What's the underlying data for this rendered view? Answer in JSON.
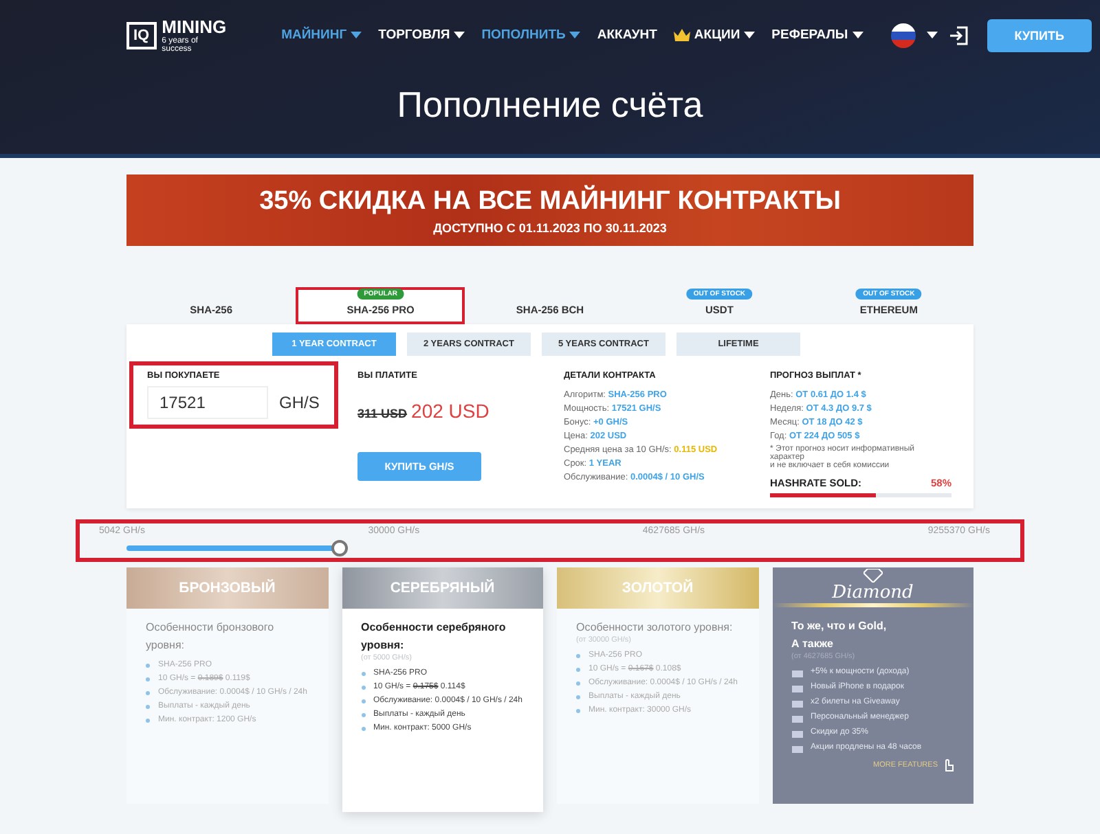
{
  "header": {
    "logo_mark": "IQ",
    "logo_name": "MINING",
    "logo_tagline": "6 years of success",
    "nav": [
      {
        "label": "МАЙНИНГ",
        "selected": true,
        "dropdown": true,
        "kind": "plain"
      },
      {
        "label": "ТОРГОВЛЯ",
        "selected": false,
        "dropdown": true,
        "kind": "plain"
      },
      {
        "label": "ПОПОЛНИТЬ",
        "selected": true,
        "dropdown": true,
        "kind": "plain"
      },
      {
        "label": "АККАУНТ",
        "selected": false,
        "dropdown": false,
        "kind": "plain"
      },
      {
        "label": "АКЦИИ",
        "selected": false,
        "dropdown": true,
        "kind": "crown"
      },
      {
        "label": "РЕФЕРАЛЫ",
        "selected": false,
        "dropdown": true,
        "kind": "plain"
      }
    ],
    "buy_button": "КУПИТЬ"
  },
  "page_title": "Пополнение счёта",
  "banner": {
    "headline": "35% СКИДКА НА ВСЕ МАЙНИНГ КОНТРАКТЫ",
    "subline": "ДОСТУПНО С 01.11.2023 ПО 30.11.2023"
  },
  "algo_tabs": [
    {
      "label": "SHA-256",
      "selected": false,
      "highlighted": false
    },
    {
      "label": "SHA-256 PRO",
      "selected": true,
      "highlighted": true,
      "badge": {
        "text": "POPULAR",
        "color": "#2e9a3a"
      }
    },
    {
      "label": "SHA-256 BCH",
      "selected": false,
      "highlighted": false
    },
    {
      "label": "USDT",
      "selected": false,
      "highlighted": false,
      "badge": {
        "text": "OUT OF STOCK",
        "color": "#3aa0e6"
      }
    },
    {
      "label": "ETHEREUM",
      "selected": false,
      "highlighted": false,
      "badge": {
        "text": "OUT OF STOCK",
        "color": "#3aa0e6"
      }
    }
  ],
  "contract_tabs": [
    {
      "label": "1 YEAR CONTRACT",
      "selected": true
    },
    {
      "label": "2 YEARS CONTRACT",
      "selected": false
    },
    {
      "label": "5 YEARS CONTRACT",
      "selected": false
    },
    {
      "label": "LIFETIME",
      "selected": false
    }
  ],
  "purchase": {
    "heading": "ВЫ ПОКУПАЕТЕ",
    "value": "17521",
    "unit": "GH/S",
    "highlighted": true
  },
  "payment": {
    "heading": "ВЫ ПЛАТИТЕ",
    "old_price": "311 USD",
    "price": "202 USD",
    "button": "КУПИТЬ GH/S"
  },
  "details": {
    "heading": "ДЕТАЛИ КОНТРАКТА",
    "rows": [
      {
        "label": "Алгоритм:",
        "value": "SHA-256 PRO",
        "color": "#3fa3e6"
      },
      {
        "label": "Мощность:",
        "value": "17521 GH/S",
        "color": "#3fa3e6"
      },
      {
        "label": "Бонус:",
        "value": "+0 GH/S",
        "color": "#3fa3e6"
      },
      {
        "label": "Цена:",
        "value": "202 USD",
        "color": "#3fa3e6"
      },
      {
        "label": "Средняя цена за 10 GH/s:",
        "value": "0.115 USD",
        "color": "#e6b800"
      },
      {
        "label": "Срок:",
        "value": "1 YEAR",
        "color": "#3fa3e6"
      },
      {
        "label": "Обслуживание:",
        "value": "0.0004$ / 10 GH/S",
        "color": "#3fa3e6"
      }
    ]
  },
  "forecast": {
    "heading": "ПРОГНОЗ ВЫПЛАТ *",
    "rows": [
      {
        "label": "День:",
        "value": "ОТ 0.61 ДО 1.4 $"
      },
      {
        "label": "Неделя:",
        "value": "ОТ 4.3 ДО 9.7 $"
      },
      {
        "label": "Месяц:",
        "value": "ОТ 18 ДО 42 $"
      },
      {
        "label": "Год:",
        "value": "ОТ 224 ДО 505 $"
      }
    ],
    "note": [
      "* Этот прогноз носит информативный",
      "характер",
      "и не включает в себя комиссии"
    ],
    "sold_label": "HASHRATE SOLD:",
    "sold_reading": "58%",
    "level": 0.58
  },
  "hashrate_slider": {
    "highlighted": true,
    "level": 0.25,
    "ticks": [
      "5042 GH/s",
      "30000 GH/s",
      "4627685 GH/s",
      "9255370 GH/s"
    ]
  },
  "tiers": [
    {
      "kind": "bronze",
      "title": "БРОНЗОВЫЙ",
      "selected": false,
      "heading": "Особенности бронзового уровня:",
      "features": [
        {
          "kind": "text",
          "text": "SHA-256 PRO"
        },
        {
          "kind": "price",
          "text": "10 GH/s =",
          "old": "0.189$",
          "new": "0.119$"
        },
        {
          "kind": "text",
          "text": "Обслуживание: 0.0004$ / 10 GH/s / 24h"
        },
        {
          "kind": "text",
          "text": "Выплаты - каждый день"
        },
        {
          "kind": "text",
          "text": "Мин. контракт: 1200 GH/s"
        }
      ]
    },
    {
      "kind": "silver",
      "title": "СЕРЕБРЯНЫЙ",
      "selected": true,
      "heading": "Особенности серебряного уровня:",
      "threshold": "(от 5000 GH/s)",
      "features": [
        {
          "kind": "text",
          "text": "SHA-256 PRO"
        },
        {
          "kind": "price",
          "text": "10 GH/s =",
          "old": "0.175$",
          "new": "0.114$"
        },
        {
          "kind": "text",
          "text": "Обслуживание: 0.0004$ / 10 GH/s / 24h"
        },
        {
          "kind": "text",
          "text": "Выплаты - каждый день"
        },
        {
          "kind": "text",
          "text": "Мин. контракт: 5000 GH/s"
        }
      ]
    },
    {
      "kind": "gold",
      "title": "ЗОЛОТОЙ",
      "selected": false,
      "heading": "Особенности золотого уровня:",
      "threshold": "(от 30000 GH/s)",
      "features": [
        {
          "kind": "text",
          "text": "SHA-256 PRO"
        },
        {
          "kind": "price",
          "text": "10 GH/s =",
          "old": "0.167$",
          "new": "0.108$"
        },
        {
          "kind": "text",
          "text": "Обслуживание: 0.0004$ / 10 GH/s / 24h"
        },
        {
          "kind": "text",
          "text": "Выплаты - каждый день"
        },
        {
          "kind": "text",
          "text": "Мин. контракт: 30000 GH/s"
        }
      ]
    },
    {
      "kind": "diamond",
      "title": "Diamond",
      "selected": false,
      "heading": "То же, что и Gold,",
      "heading2": "А также",
      "threshold": "(от 4627685 GH/s)",
      "features": [
        {
          "kind": "text",
          "text": "+5% к мощности (дохода)"
        },
        {
          "kind": "text",
          "text": "Новый iPhone в подарок"
        },
        {
          "kind": "text",
          "text": "x2 билеты на Giveaway"
        },
        {
          "kind": "text",
          "text": "Персональный менеджер"
        },
        {
          "kind": "text",
          "text": "Скидки до 35%"
        },
        {
          "kind": "text",
          "text": "Акции продлены на 48 часов"
        }
      ],
      "more": "MORE FEATURES"
    }
  ]
}
